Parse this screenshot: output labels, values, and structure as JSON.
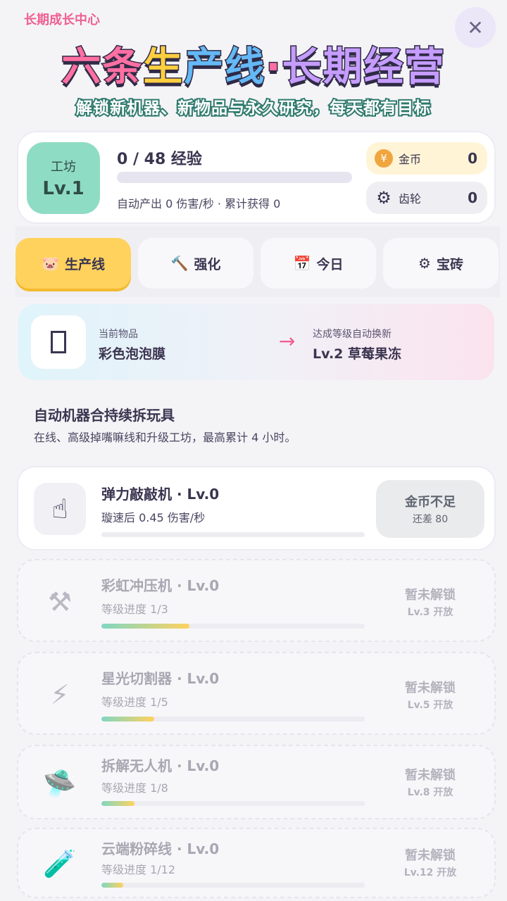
{
  "header": {
    "tag": "长期成长中心",
    "title_parts": [
      "六条",
      "生",
      "产线",
      "·",
      "长期经营"
    ],
    "subtitle": "解锁新机器、新物品与永久研究，每天都有目标",
    "close_glyph": "✕"
  },
  "workshop": {
    "badge_label": "工坊",
    "level_label": "Lv.1",
    "exp_text": "0 / 48 经验",
    "exp_progress": 0,
    "auto_stats": "自动产出 0 伤害/秒 · 累计获得 0"
  },
  "currencies": {
    "gold": {
      "label": "金币",
      "value": "0",
      "icon": "coin-icon"
    },
    "gear": {
      "label": "齿轮",
      "value": "0",
      "icon": "gear-icon"
    }
  },
  "tabs": [
    {
      "label": "生产线",
      "icon": "pig-icon",
      "glyph": "🐷",
      "active": true
    },
    {
      "label": "强化",
      "icon": "hammer-icon",
      "glyph": "🔨",
      "active": false
    },
    {
      "label": "今日",
      "icon": "calendar-icon",
      "glyph": "📅",
      "active": false
    },
    {
      "label": "宝砖",
      "icon": "gear-icon",
      "glyph": "⚙",
      "active": false
    }
  ],
  "product": {
    "current_label": "当前物品",
    "current_name": "彩色泡泡膜",
    "arrow": "→",
    "next_label": "达成等级自动换新",
    "next_name": "Lv.2 草莓果冻"
  },
  "section": {
    "title": "自动机器合持续拆玩具",
    "desc": "在线、高级掉嘴嘛线和升级工坊，最高累计 4 小时。"
  },
  "machines": [
    {
      "name": "弹力敲敲机 · Lv.0",
      "sub": "璇速后 0.45 伤害/秒",
      "progress": 0,
      "action_main": "金币不足",
      "action_sub": "还差 80",
      "icon": "finger-icon",
      "glyph": "☝",
      "locked": false
    },
    {
      "name": "彩虹冲压机 · Lv.0",
      "sub": "等级进度 1/3",
      "progress": 0.333,
      "action_main": "暂未解锁",
      "action_sub": "Lv.3 开放",
      "icon": "press-icon",
      "glyph": "⚒",
      "locked": true
    },
    {
      "name": "星光切割器 · Lv.0",
      "sub": "等级进度 1/5",
      "progress": 0.2,
      "action_main": "暂未解锁",
      "action_sub": "Lv.5 开放",
      "icon": "lightning-icon",
      "glyph": "⚡",
      "locked": true
    },
    {
      "name": "拆解无人机 · Lv.0",
      "sub": "等级进度 1/8",
      "progress": 0.125,
      "action_main": "暂未解锁",
      "action_sub": "Lv.8 开放",
      "icon": "ufo-icon",
      "glyph": "🛸",
      "locked": true
    },
    {
      "name": "云端粉碎线 · Lv.0",
      "sub": "等级进度 1/12",
      "progress": 0.083,
      "action_main": "暂未解锁",
      "action_sub": "Lv.12 开放",
      "icon": "test-tube-icon",
      "glyph": "🧪",
      "locked": true
    }
  ]
}
